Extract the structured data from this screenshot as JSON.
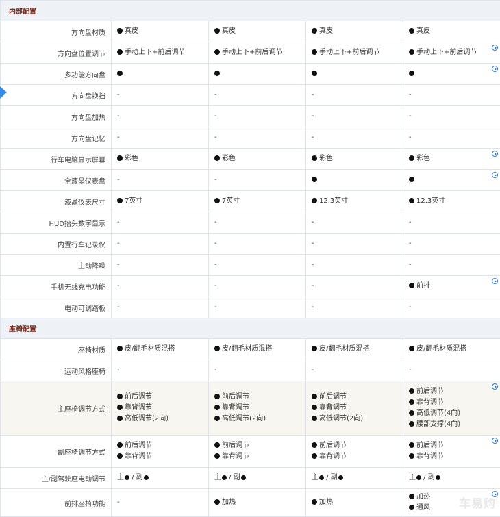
{
  "sections": [
    {
      "title": "内部配置",
      "rows": [
        {
          "label": "方向盘材质",
          "values": [
            [
              "●真皮"
            ],
            [
              "●真皮"
            ],
            [
              "●真皮"
            ],
            [
              "●真皮"
            ]
          ]
        },
        {
          "label": "方向盘位置调节",
          "values": [
            [
              "●手动上下+前后调节"
            ],
            [
              "●手动上下+前后调节"
            ],
            [
              "●手动上下+前后调节"
            ],
            [
              "●手动上下+前后调节"
            ]
          ],
          "more": true
        },
        {
          "label": "多功能方向盘",
          "values": [
            [
              "●"
            ],
            [
              "●"
            ],
            [
              "●"
            ],
            [
              "●"
            ]
          ],
          "more": true
        },
        {
          "label": "方向盘换挡",
          "values": [
            [
              "-"
            ],
            [
              "-"
            ],
            [
              "-"
            ],
            [
              "-"
            ]
          ]
        },
        {
          "label": "方向盘加热",
          "values": [
            [
              "-"
            ],
            [
              "-"
            ],
            [
              "-"
            ],
            [
              "-"
            ]
          ]
        },
        {
          "label": "方向盘记忆",
          "values": [
            [
              "-"
            ],
            [
              "-"
            ],
            [
              "-"
            ],
            [
              "-"
            ]
          ]
        },
        {
          "label": "行车电脑显示屏幕",
          "values": [
            [
              "●彩色"
            ],
            [
              "●彩色"
            ],
            [
              "●彩色"
            ],
            [
              "●彩色"
            ]
          ],
          "more": true
        },
        {
          "label": "全液晶仪表盘",
          "values": [
            [
              "-"
            ],
            [
              "-"
            ],
            [
              "●"
            ],
            [
              "●"
            ]
          ],
          "more": true
        },
        {
          "label": "液晶仪表尺寸",
          "values": [
            [
              "●7英寸"
            ],
            [
              "●7英寸"
            ],
            [
              "●12.3英寸"
            ],
            [
              "●12.3英寸"
            ]
          ]
        },
        {
          "label": "HUD抬头数字显示",
          "values": [
            [
              "-"
            ],
            [
              "-"
            ],
            [
              "-"
            ],
            [
              "-"
            ]
          ]
        },
        {
          "label": "内置行车记录仪",
          "values": [
            [
              "-"
            ],
            [
              "-"
            ],
            [
              "-"
            ],
            [
              "-"
            ]
          ]
        },
        {
          "label": "主动降噪",
          "values": [
            [
              "-"
            ],
            [
              "-"
            ],
            [
              "-"
            ],
            [
              "-"
            ]
          ]
        },
        {
          "label": "手机无线充电功能",
          "values": [
            [
              "-"
            ],
            [
              "-"
            ],
            [
              "-"
            ],
            [
              "●前排"
            ]
          ],
          "more": true
        },
        {
          "label": "电动可调踏板",
          "values": [
            [
              "-"
            ],
            [
              "-"
            ],
            [
              "-"
            ],
            [
              "-"
            ]
          ]
        }
      ]
    },
    {
      "title": "座椅配置",
      "rows": [
        {
          "label": "座椅材质",
          "values": [
            [
              "●皮/翻毛材质混搭"
            ],
            [
              "●皮/翻毛材质混搭"
            ],
            [
              "●皮/翻毛材质混搭"
            ],
            [
              "●皮/翻毛材质混搭"
            ]
          ]
        },
        {
          "label": "运动风格座椅",
          "values": [
            [
              "-"
            ],
            [
              "-"
            ],
            [
              "-"
            ],
            [
              "-"
            ]
          ]
        },
        {
          "label": "主座椅调节方式",
          "highlight": true,
          "more": true,
          "values": [
            [
              "●前后调节",
              "●靠背调节",
              "●高低调节(2向)"
            ],
            [
              "●前后调节",
              "●靠背调节",
              "●高低调节(2向)"
            ],
            [
              "●前后调节",
              "●靠背调节",
              "●高低调节(2向)"
            ],
            [
              "●前后调节",
              "●靠背调节",
              "●高低调节(4向)",
              "●腰部支撑(4向)"
            ]
          ]
        },
        {
          "label": "副座椅调节方式",
          "more": true,
          "values": [
            [
              "●前后调节",
              "●靠背调节"
            ],
            [
              "●前后调节",
              "●靠背调节"
            ],
            [
              "●前后调节",
              "●靠背调节"
            ],
            [
              "●前后调节",
              "●靠背调节"
            ]
          ]
        },
        {
          "label": "主/副驾驶座电动调节",
          "values": [
            [
              "主● / 副●"
            ],
            [
              "主● / 副●"
            ],
            [
              "主● / 副●"
            ],
            [
              "主● / 副●"
            ]
          ]
        },
        {
          "label": "前排座椅功能",
          "more": true,
          "values": [
            [
              "-"
            ],
            [
              "●加热"
            ],
            [
              "●加热"
            ],
            [
              "●加热",
              "●通风"
            ]
          ]
        }
      ]
    }
  ],
  "watermark": "车易购"
}
